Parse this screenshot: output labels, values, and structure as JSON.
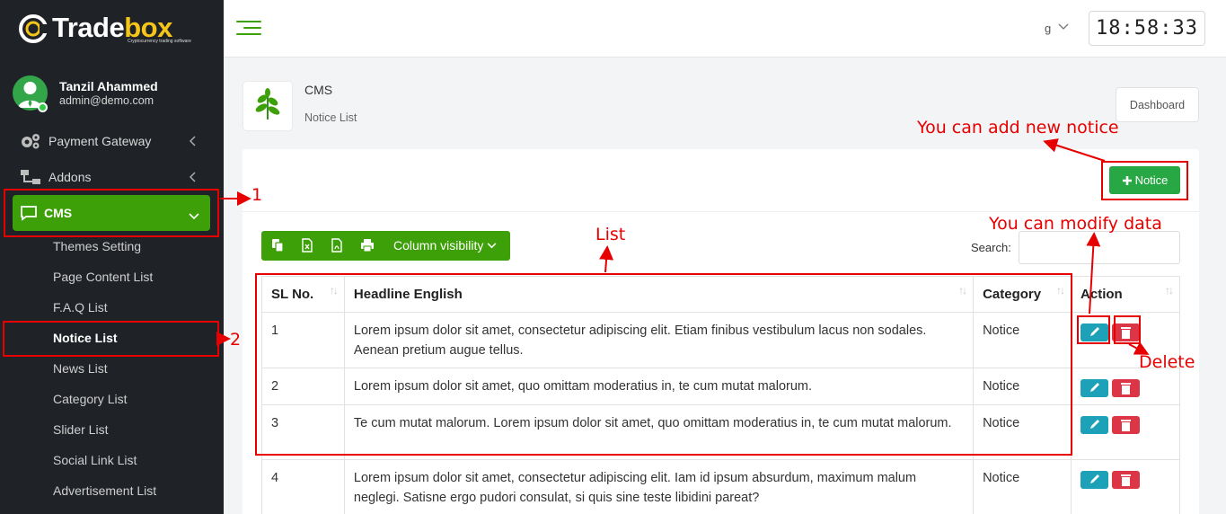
{
  "brand": {
    "name_part1": "Trade",
    "name_part2": "box",
    "tagline": "Cryptocurrency trading software"
  },
  "user": {
    "name": "Tanzil Ahammed",
    "email": "admin@demo.com"
  },
  "sidebar": {
    "items": [
      {
        "label": "Payment Gateway",
        "icon": "gears-icon"
      },
      {
        "label": "Addons",
        "icon": "sitemap-icon"
      }
    ],
    "active_group": {
      "label": "CMS",
      "icon": "chat-icon"
    },
    "sub_items": [
      "Themes Setting",
      "Page Content List",
      "F.A.Q List",
      "Notice List",
      "News List",
      "Category List",
      "Slider List",
      "Social Link List",
      "Advertisement List"
    ],
    "active_sub_index": 3
  },
  "topbar": {
    "language": "g",
    "clock": "18:58:33"
  },
  "page": {
    "title": "CMS",
    "subtitle": "Notice List",
    "dashboard_button": "Dashboard"
  },
  "toolbar": {
    "add_notice": "Notice",
    "column_visibility": "Column visibility",
    "search_label": "Search:"
  },
  "table": {
    "headers": [
      "SL No.",
      "Headline English",
      "Category",
      "Action"
    ],
    "rows": [
      {
        "sl": "1",
        "headline": "Lorem ipsum dolor sit amet, consectetur adipiscing elit. Etiam finibus vestibulum lacus non sodales. Aenean pretium augue tellus.",
        "category": "Notice"
      },
      {
        "sl": "2",
        "headline": "Lorem ipsum dolor sit amet, quo omittam moderatius in, te cum mutat malorum.",
        "category": "Notice"
      },
      {
        "sl": "3",
        "headline": "Te cum mutat malorum. Lorem ipsum dolor sit amet, quo omittam moderatius in, te cum mutat malorum.",
        "category": "Notice"
      },
      {
        "sl": "4",
        "headline": "Lorem ipsum dolor sit amet, consectetur adipiscing elit. Iam id ipsum absurdum, maximum malum neglegi. Satisne ergo pudori consulat, si quis sine teste libidini pareat?",
        "category": "Notice"
      }
    ]
  },
  "annotations": {
    "label_1": "1",
    "label_2": "2",
    "add_notice_hint": "You can add new notice",
    "modify_hint": "You can modify data",
    "list_hint": "List",
    "delete_hint": "Delete"
  },
  "colors": {
    "sidebar_bg": "#1f2227",
    "accent_green": "#3ea008",
    "button_green": "#28a745",
    "edit_blue": "#1da1b8",
    "delete_red": "#dc3545",
    "annotation_red": "#e60000"
  }
}
